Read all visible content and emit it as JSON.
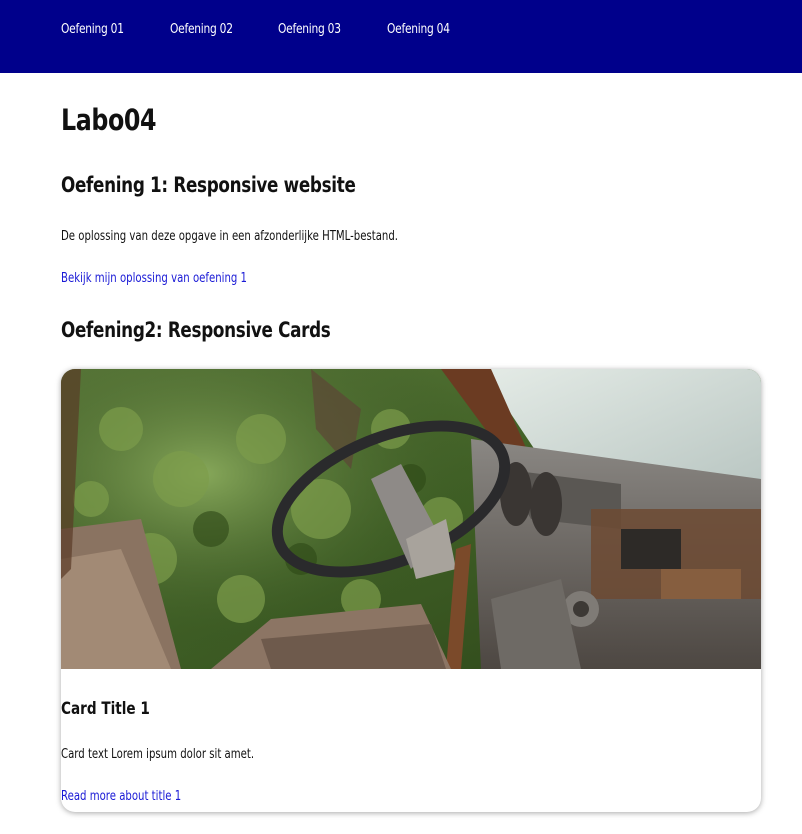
{
  "nav": {
    "items": [
      {
        "label": "Oefening 01"
      },
      {
        "label": "Oefening 02"
      },
      {
        "label": "Oefening 03"
      },
      {
        "label": "Oefening 04"
      }
    ]
  },
  "page": {
    "title": "Labo04"
  },
  "exercise1": {
    "heading": "Oefening 1: Responsive website",
    "text": "De oplossing van deze opgave in een afzonderlijke HTML-bestand.",
    "link": "Bekijk mijn oplossing van oefening 1"
  },
  "exercise2": {
    "heading": "Oefening2: Responsive Cards",
    "card": {
      "title": "Card Title 1",
      "text": "Card text Lorem ipsum dolor sit amet.",
      "link": "Read more about title 1",
      "image_subject": "abandoned car interior overgrown with plants"
    }
  },
  "colors": {
    "nav_background": "#00008b",
    "link": "#1a1ad6"
  }
}
